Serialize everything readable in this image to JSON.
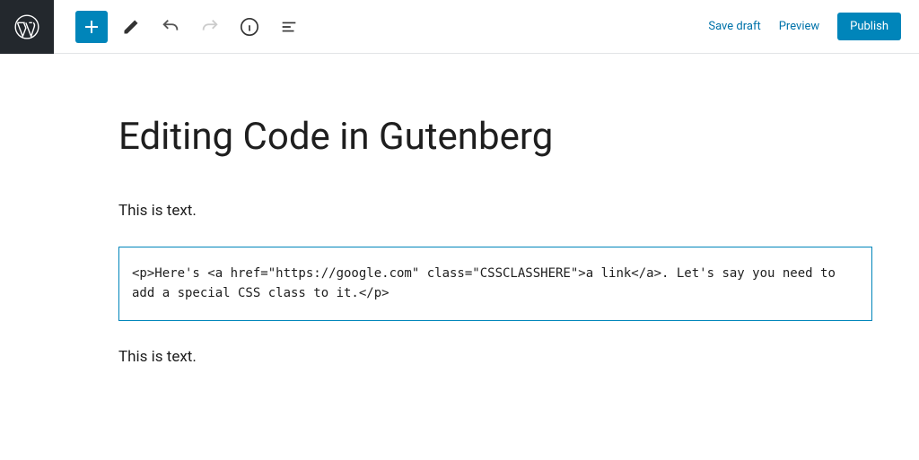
{
  "header": {
    "save_draft": "Save draft",
    "preview": "Preview",
    "publish": "Publish"
  },
  "post": {
    "title": "Editing Code in Gutenberg",
    "block1": "This is text.",
    "code": "<p>Here's <a href=\"https://google.com\" class=\"CSSCLASSHERE\">a link</a>. Let's say you need to add a special CSS class to it.</p>",
    "block3": "This is text."
  }
}
